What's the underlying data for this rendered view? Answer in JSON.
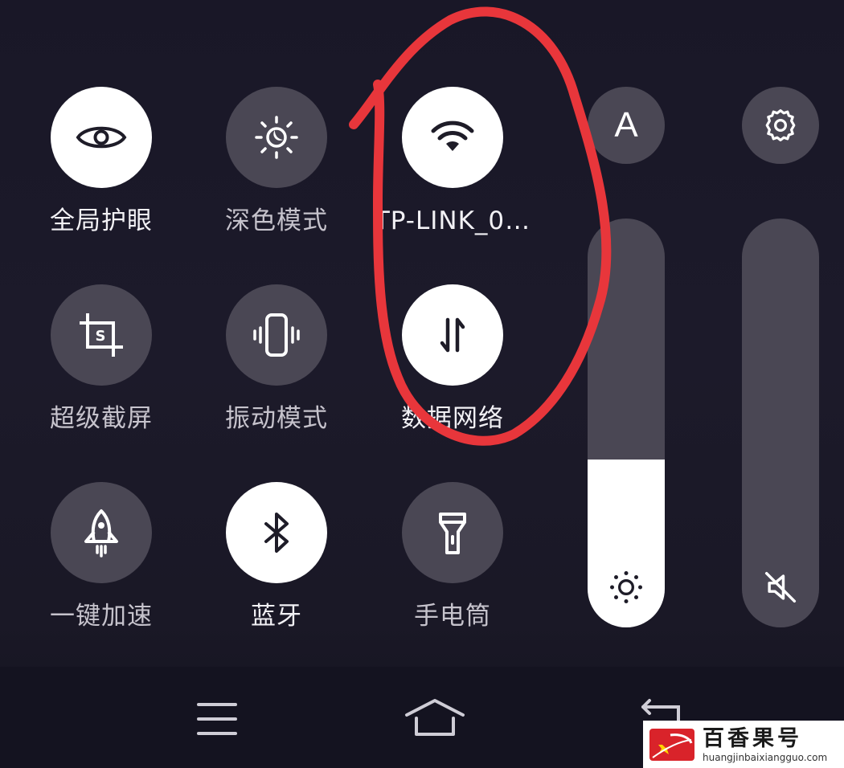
{
  "tiles": [
    {
      "label": "全局护眼",
      "state": "on",
      "icon": "eye-icon"
    },
    {
      "label": "深色模式",
      "state": "off",
      "icon": "dark-mode-icon"
    },
    {
      "label": "TP-LINK_0…",
      "state": "on",
      "icon": "wifi-icon"
    },
    {
      "label": "超级截屏",
      "state": "off",
      "icon": "screenshot-icon"
    },
    {
      "label": "振动模式",
      "state": "off",
      "icon": "vibrate-icon"
    },
    {
      "label": "数据网络",
      "state": "on",
      "icon": "mobile-data-icon"
    },
    {
      "label": "一键加速",
      "state": "off",
      "icon": "rocket-icon"
    },
    {
      "label": "蓝牙",
      "state": "on",
      "icon": "bluetooth-icon"
    },
    {
      "label": "手电筒",
      "state": "off",
      "icon": "flashlight-icon"
    }
  ],
  "side_controls": {
    "auto_brightness_label": "A",
    "settings_icon": "gear-icon",
    "brightness_level": 0.41,
    "brightness_icon": "sun-icon",
    "volume_level": 0.0,
    "volume_icon": "mute-icon"
  },
  "navbar": {
    "menu_icon": "menu-icon",
    "home_icon": "home-icon",
    "back_icon": "back-icon"
  },
  "watermark": {
    "title": "百香果号",
    "url": "huangjinbaixiangguo.com"
  },
  "colors": {
    "tile_on": "#ffffff",
    "tile_off": "#4a4754",
    "annotation_red": "#e8363b"
  }
}
